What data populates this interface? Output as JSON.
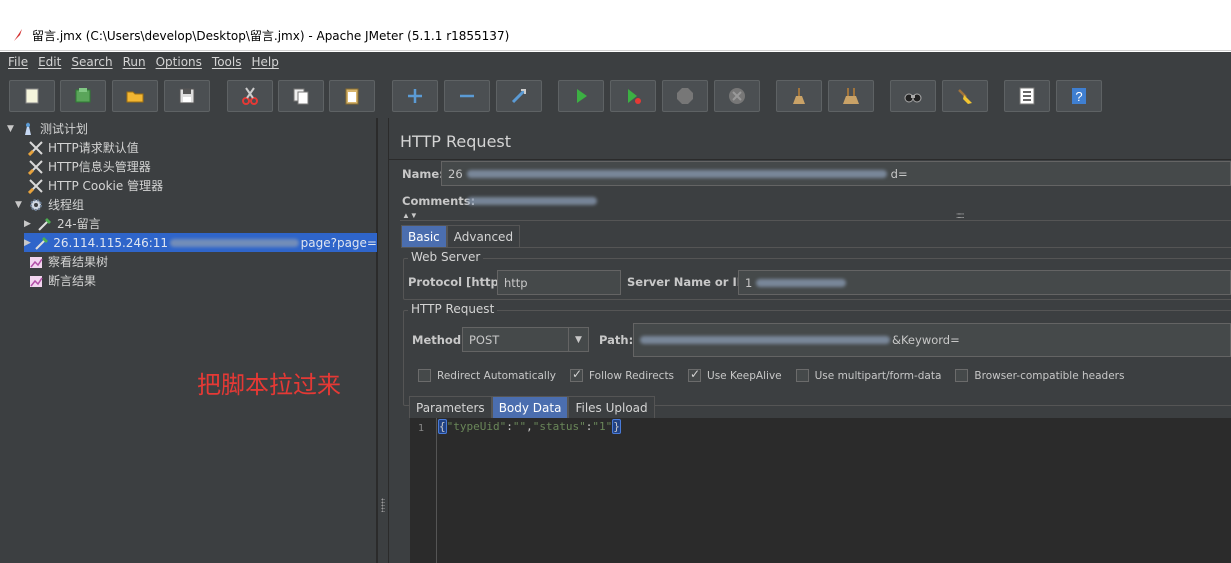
{
  "window": {
    "title": "留言.jmx (C:\\Users\\develop\\Desktop\\留言.jmx) - Apache JMeter (5.1.1 r1855137)"
  },
  "menu": [
    "File",
    "Edit",
    "Search",
    "Run",
    "Options",
    "Tools",
    "Help"
  ],
  "toolbar_icons": [
    "new-icon",
    "templates-icon",
    "open-icon",
    "save-icon",
    "cut-icon",
    "copy-icon",
    "paste-icon",
    "expand-icon",
    "collapse-icon",
    "toggle-icon",
    "start-icon",
    "start-no-pause-icon",
    "stop-icon",
    "shutdown-icon",
    "clear-icon",
    "clear-all-icon",
    "search-icon",
    "reset-search-icon",
    "function-helper-icon",
    "help-icon"
  ],
  "tree": {
    "items": [
      {
        "label": "测试计划"
      },
      {
        "label": "HTTP请求默认值"
      },
      {
        "label": "HTTP信息头管理器"
      },
      {
        "label": "HTTP Cookie 管理器"
      },
      {
        "label": "线程组"
      },
      {
        "label": "24-留言"
      },
      {
        "label_prefix": "26.114.115.246:11",
        "label_suffix": "page?page="
      },
      {
        "label": "察看结果树"
      },
      {
        "label": "断言结果"
      }
    ]
  },
  "annotation": "把脚本拉过来",
  "panel": {
    "title": "HTTP Request",
    "name_label": "Name:",
    "name_value": "26",
    "name_value_suffix": "d=",
    "comments_label": "Comments:",
    "tabs": [
      "Basic",
      "Advanced"
    ],
    "web_server_title": "Web Server",
    "protocol_label": "Protocol [http]:",
    "protocol_value": "http",
    "server_label": "Server Name or IP:",
    "server_value": "1",
    "http_request_title": "HTTP Request",
    "method_label": "Method:",
    "method_value": "POST",
    "path_label": "Path:",
    "path_value": "&Keyword=",
    "checkboxes": [
      {
        "label": "Redirect Automatically",
        "checked": false
      },
      {
        "label": "Follow Redirects",
        "checked": true
      },
      {
        "label": "Use KeepAlive",
        "checked": true
      },
      {
        "label": "Use multipart/form-data",
        "checked": false
      },
      {
        "label": "Browser-compatible headers",
        "checked": false
      }
    ],
    "subtabs": [
      "Parameters",
      "Body Data",
      "Files Upload"
    ],
    "body": {
      "line_number": "1",
      "key1": "\"typeUid\"",
      "val1": "\"\"",
      "key2": "\"status\"",
      "val2": "\"1\""
    }
  },
  "colors": {
    "background": "#3c3f41",
    "selection": "#2f65ca",
    "active_tab": "#4b6eaf",
    "annotation": "#e53935"
  }
}
